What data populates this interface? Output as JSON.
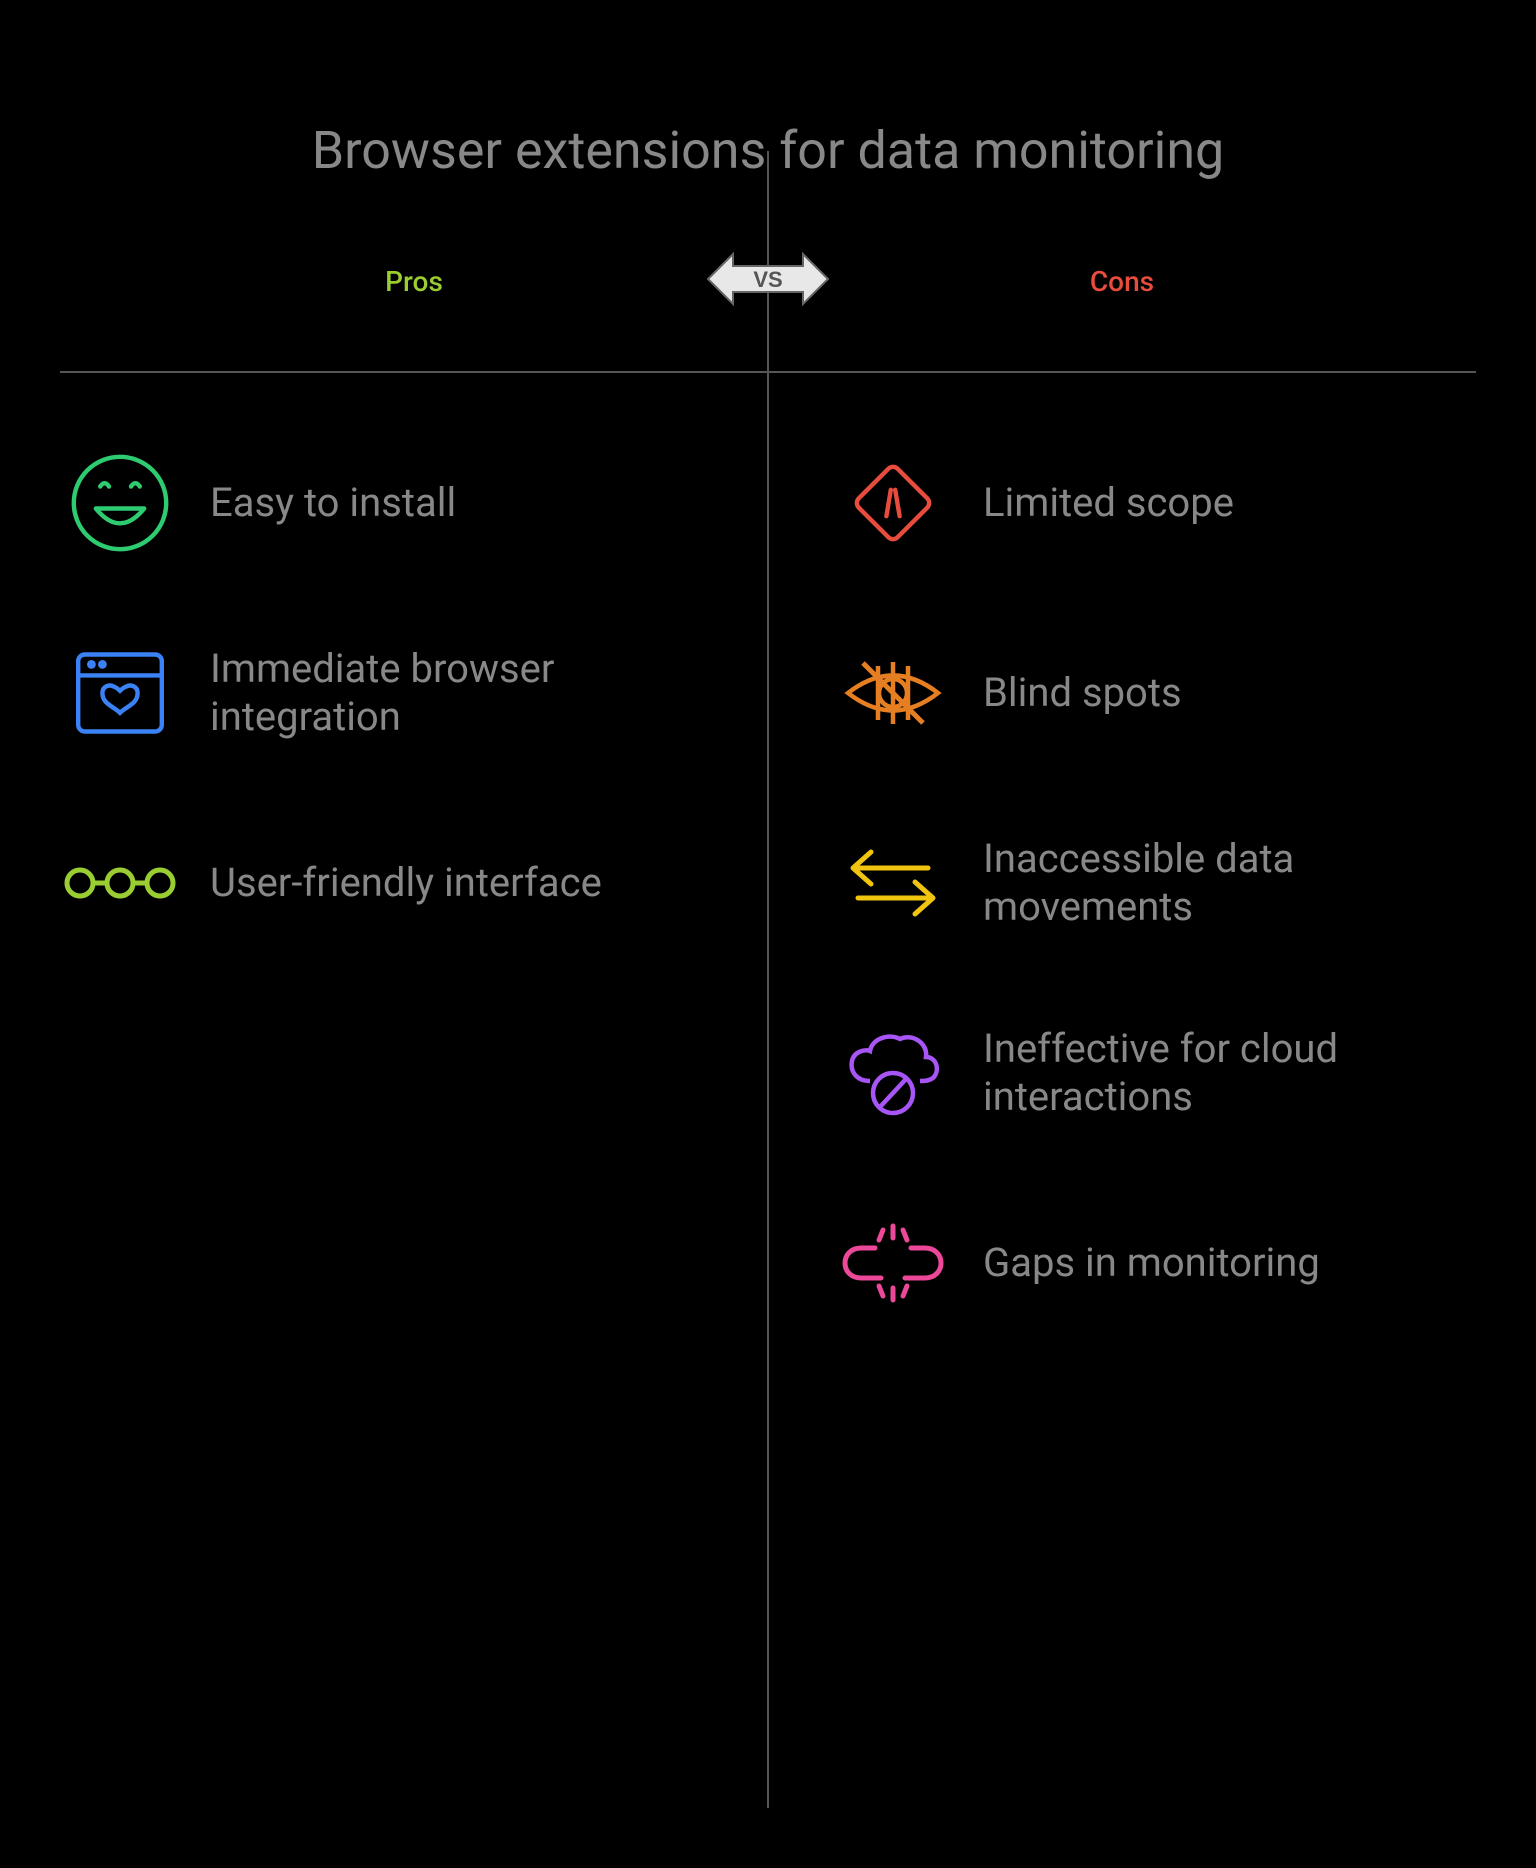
{
  "title": "Browser extensions for data monitoring",
  "headers": {
    "left": "Pros",
    "right": "Cons",
    "vs": "VS"
  },
  "colors": {
    "pros": "#9acd32",
    "cons": "#e74c3c",
    "smile": "#2ecc71",
    "browser": "#3b82f6",
    "glasses": "#9acd32",
    "diamond": "#e74c3c",
    "eye": "#e67e22",
    "arrows": "#f1c40f",
    "cloud": "#a855f7",
    "link": "#ec4899"
  },
  "pros": [
    {
      "label": "Easy to install",
      "icon": "smile"
    },
    {
      "label": "Immediate browser integration",
      "icon": "browser-heart"
    },
    {
      "label": "User-friendly interface",
      "icon": "glasses"
    }
  ],
  "cons": [
    {
      "label": "Limited scope",
      "icon": "diamond-road"
    },
    {
      "label": "Blind spots",
      "icon": "eye-slash"
    },
    {
      "label": "Inaccessible data movements",
      "icon": "arrows-switch"
    },
    {
      "label": "Ineffective for cloud interactions",
      "icon": "cloud-block"
    },
    {
      "label": "Gaps in monitoring",
      "icon": "broken-link"
    }
  ]
}
